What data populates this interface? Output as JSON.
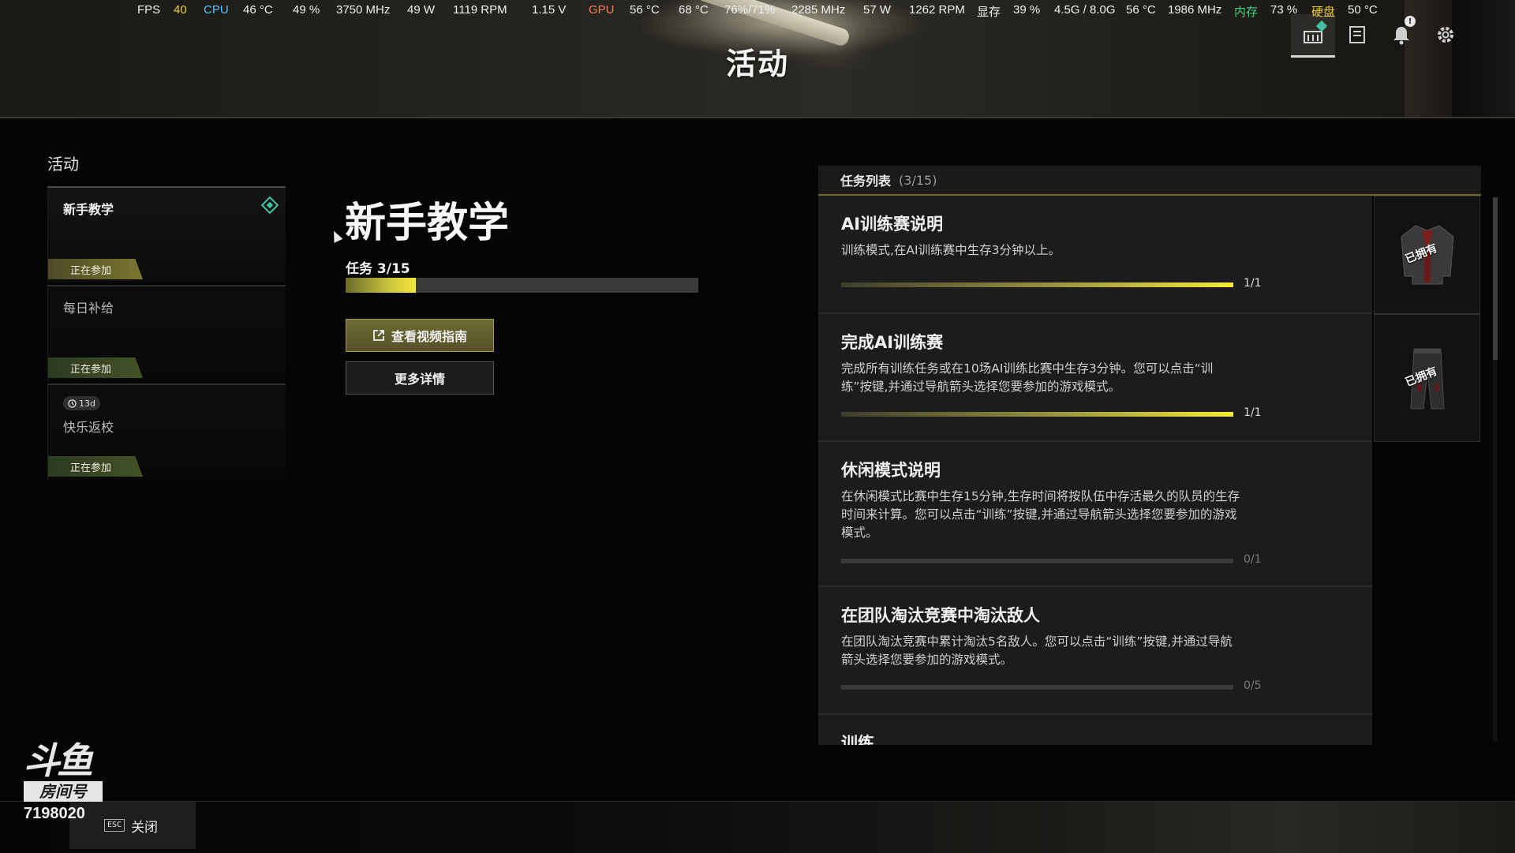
{
  "hud": {
    "fps_label": "FPS",
    "fps_value": "40",
    "cpu_label": "CPU",
    "cpu_temp": "46 °C",
    "cpu_load": "49 %",
    "cpu_clock": "3750 MHz",
    "cpu_power": "49 W",
    "cpu_fan": "1119 RPM",
    "cpu_voltage": "1.15 V",
    "gpu_label": "GPU",
    "gpu_temp": "56 °C",
    "gpu_hotspot": "68 °C",
    "gpu_load": "76%/71%",
    "gpu_clock": "2285 MHz",
    "gpu_power": "57 W",
    "gpu_fan": "1262 RPM",
    "vram_label": "显存",
    "vram_load": "39 %",
    "vram_usage": "4.5G / 8.0G",
    "vram_temp": "56 °C",
    "vram_clock": "1986 MHz",
    "mem_label": "内存",
    "mem_load": "73 %",
    "disk_label": "硬盘",
    "disk_temp": "50 °C"
  },
  "header": {
    "title": "活动",
    "notification_badge": "!"
  },
  "sidebar": {
    "section_label": "活动",
    "items": [
      {
        "name": "新手教学",
        "status": "正在参加",
        "selected": true
      },
      {
        "name": "每日补给",
        "status": "正在参加",
        "selected": false
      },
      {
        "name": "快乐返校",
        "status": "正在参加",
        "selected": false,
        "timer": "13d"
      }
    ]
  },
  "detail": {
    "title": "新手教学",
    "task_progress_label": "任务 3/15",
    "progress_fraction": 0.2,
    "video_button": "查看视频指南",
    "more_button": "更多详情"
  },
  "task_list": {
    "title": "任务列表",
    "count": "(3/15)",
    "tasks": [
      {
        "title": "AI训练赛说明",
        "desc": "训练模式,在AI训练赛中生存3分钟以上。",
        "progress": "1/1",
        "fraction": 1,
        "reward_label": "已拥有",
        "reward_icon": "jacket-icon"
      },
      {
        "title": "完成AI训练赛",
        "desc": "完成所有训练任务或在10场AI训练比赛中生存3分钟。您可以点击“训练”按键,并通过导航箭头选择您要参加的游戏模式。",
        "progress": "1/1",
        "fraction": 1,
        "reward_label": "已拥有",
        "reward_icon": "pants-icon"
      },
      {
        "title": "休闲模式说明",
        "desc": "在休闲模式比赛中生存15分钟,生存时间将按队伍中存活最久的队员的生存时间来计算。您可以点击“训练”按键,并通过导航箭头选择您要参加的游戏模式。",
        "progress": "0/1",
        "fraction": 0
      },
      {
        "title": "在团队淘汰竞赛中淘汰敌人",
        "desc": "在团队淘汰竞赛中累计淘汰5名敌人。您可以点击“训练”按键,并通过导航箭头选择您要参加的游戏模式。",
        "progress": "0/5",
        "fraction": 0
      },
      {
        "title": "训练",
        "desc": "",
        "progress": "",
        "fraction": 0
      }
    ]
  },
  "footer": {
    "esc_key": "ESC",
    "close_label": "关闭"
  },
  "watermark": {
    "logo": "斗鱼",
    "room_label": "房间号",
    "room_id": "7198020"
  }
}
